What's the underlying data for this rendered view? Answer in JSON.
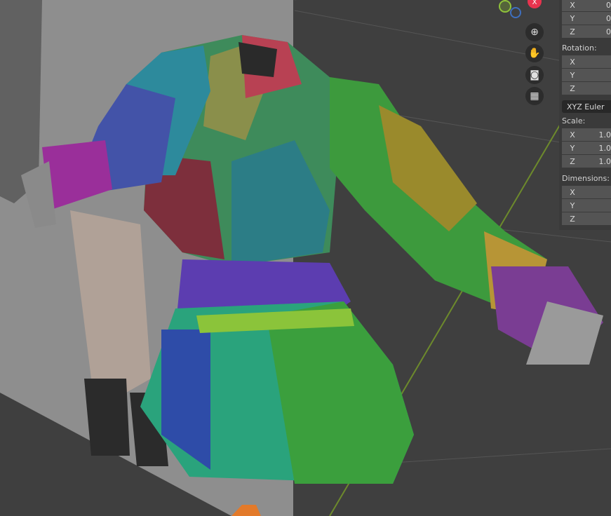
{
  "viewport": {
    "axis_gizmo": {
      "x_label": "X",
      "colors": {
        "x": "#e8334e",
        "y": "#7db02c",
        "z": "#3e6fbf"
      }
    },
    "nav_buttons": [
      {
        "name": "zoom-icon",
        "glyph": "⊕"
      },
      {
        "name": "pan-hand-icon",
        "glyph": "✋"
      },
      {
        "name": "camera-icon",
        "glyph": "🎥"
      },
      {
        "name": "grid-perspective-icon",
        "glyph": "▦"
      }
    ]
  },
  "properties": {
    "location": {
      "x": "0",
      "y": "0",
      "z": "0"
    },
    "rotation_label": "Rotation:",
    "rotation": {
      "x": "",
      "y": "",
      "z": ""
    },
    "rotation_mode": "XYZ Euler",
    "scale_label": "Scale:",
    "scale": {
      "x": "1.0",
      "y": "1.0",
      "z": "1.0"
    },
    "dimensions_label": "Dimensions:",
    "dimensions": {
      "x": "",
      "y": "",
      "z": ""
    },
    "axis_labels": {
      "x": "X",
      "y": "Y",
      "z": "Z"
    }
  }
}
